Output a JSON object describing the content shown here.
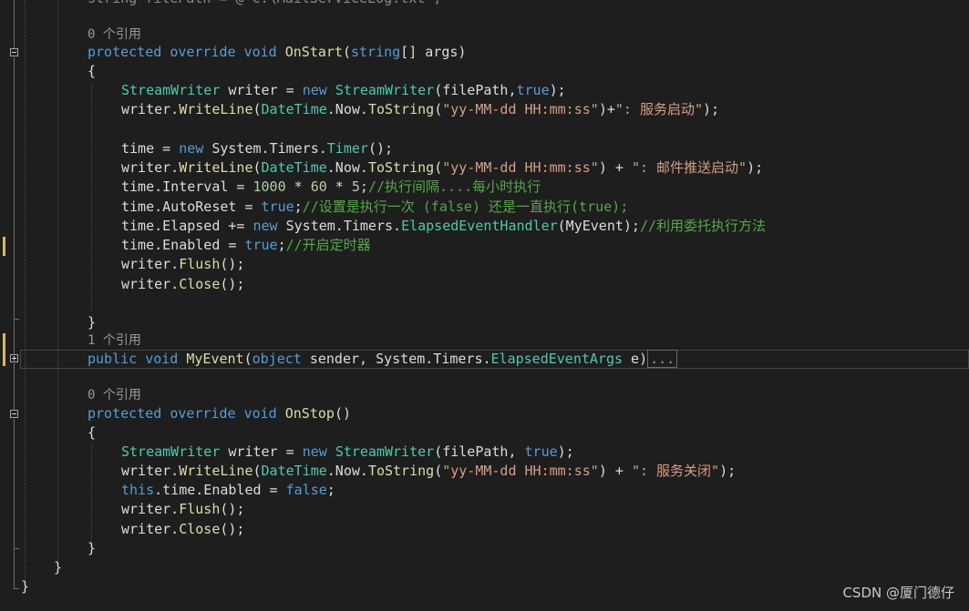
{
  "editor": {
    "lines": {
      "top_partial": "string filePath = @\"C:\\MailServiceLog.txt\";",
      "ref_onstart": "0 个引用",
      "onstart_sig": {
        "p1": "protected",
        "p2": "override",
        "p3": "void",
        "p4": "OnStart",
        "p5": "(",
        "p6": "string",
        "p7": "[] args)"
      },
      "brace_open1": "{",
      "l1": {
        "t1": "StreamWriter",
        "t2": " writer = ",
        "t3": "new",
        "t4": " ",
        "t5": "StreamWriter",
        "t6": "(filePath,",
        "t7": "true",
        "t8": ");"
      },
      "l2": {
        "t1": "writer.",
        "t2": "WriteLine",
        "t3": "(",
        "t4": "DateTime",
        "t5": ".Now.",
        "t6": "ToString",
        "t7": "(",
        "t8": "\"yy-MM-dd HH:mm:ss\"",
        "t9": ")+",
        "t10": "\": 服务启动\"",
        "t11": ");"
      },
      "l3": {
        "t1": "time = ",
        "t2": "new",
        "t3": " System.Timers.",
        "t4": "Timer",
        "t5": "();"
      },
      "l4": {
        "t1": "writer.",
        "t2": "WriteLine",
        "t3": "(",
        "t4": "DateTime",
        "t5": ".Now.",
        "t6": "ToString",
        "t7": "(",
        "t8": "\"yy-MM-dd HH:mm:ss\"",
        "t9": ") + ",
        "t10": "\": 邮件推送启动\"",
        "t11": ");"
      },
      "l5": {
        "t1": "time.Interval = ",
        "t2": "1000",
        "t3": " * ",
        "t4": "60",
        "t5": " * ",
        "t6": "5",
        "t7": ";",
        "t8": "//执行间隔....每小时执行"
      },
      "l6": {
        "t1": "time.AutoReset = ",
        "t2": "true",
        "t3": ";",
        "t4": "//设置是执行一次 (false) 还是一直执行(true);"
      },
      "l7": {
        "t1": "time.Elapsed += ",
        "t2": "new",
        "t3": " System.Timers.",
        "t4": "ElapsedEventHandler",
        "t5": "(MyEvent);",
        "t6": "//利用委托执行方法"
      },
      "l8": {
        "t1": "time.Enabled = ",
        "t2": "true",
        "t3": ";",
        "t4": "//开启定时器"
      },
      "l9": {
        "t1": "writer.",
        "t2": "Flush",
        "t3": "();"
      },
      "l10": {
        "t1": "writer.",
        "t2": "Close",
        "t3": "();"
      },
      "brace_close1": "}",
      "ref_myevent": "1 个引用",
      "myevent_sig": {
        "p1": "public",
        "p2": "void",
        "p3": "MyEvent",
        "p4": "(",
        "p5": "object",
        "p6": " sender, System.Timers.",
        "p7": "ElapsedEventArgs",
        "p8": " e)",
        "p9": "..."
      },
      "ref_onstop": "0 个引用",
      "onstop_sig": {
        "p1": "protected",
        "p2": "override",
        "p3": "void",
        "p4": "OnStop",
        "p5": "()"
      },
      "brace_open2": "{",
      "s1": {
        "t1": "StreamWriter",
        "t2": " writer = ",
        "t3": "new",
        "t4": " ",
        "t5": "StreamWriter",
        "t6": "(filePath, ",
        "t7": "true",
        "t8": ");"
      },
      "s2": {
        "t1": "writer.",
        "t2": "WriteLine",
        "t3": "(",
        "t4": "DateTime",
        "t5": ".Now.",
        "t6": "ToString",
        "t7": "(",
        "t8": "\"yy-MM-dd HH:mm:ss\"",
        "t9": ") + ",
        "t10": "\": 服务关闭\"",
        "t11": ");"
      },
      "s3": {
        "t1": "this",
        "t2": ".time.Enabled = ",
        "t3": "false",
        "t4": ";"
      },
      "s4": {
        "t1": "writer.",
        "t2": "Flush",
        "t3": "();"
      },
      "s5": {
        "t1": "writer.",
        "t2": "Close",
        "t3": "();"
      },
      "brace_close2": "}",
      "brace_close3": "}",
      "brace_close4": "}"
    }
  },
  "watermark": "CSDN @厦门德仔",
  "colors": {
    "keyword": "#569cd6",
    "type": "#4ec9b0",
    "method": "#dcdcaa",
    "string": "#d69d85",
    "comment": "#57a64a",
    "number": "#b5cea8",
    "text": "#dcdcdc"
  }
}
